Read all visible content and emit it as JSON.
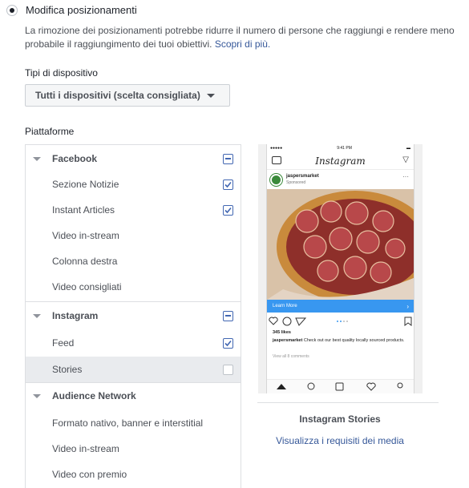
{
  "option": {
    "label": "Modifica posizionamenti",
    "description": "La rimozione dei posizionamenti potrebbe ridurre il numero di persone che raggiungi e rendere meno probabile il raggiungimento dei tuoi obiettivi.",
    "link": "Scopri di più."
  },
  "device": {
    "label": "Tipi di dispositivo",
    "selected": "Tutti i dispositivi (scelta consigliata)"
  },
  "platforms": {
    "label": "Piattaforme",
    "groups": [
      {
        "label": "Facebook",
        "state": "partial",
        "items": [
          {
            "label": "Sezione Notizie",
            "checked": true
          },
          {
            "label": "Instant Articles",
            "checked": true
          },
          {
            "label": "Video in-stream",
            "checked": false
          },
          {
            "label": "Colonna destra",
            "checked": false
          },
          {
            "label": "Video consigliati",
            "checked": false
          }
        ]
      },
      {
        "label": "Instagram",
        "state": "partial",
        "items": [
          {
            "label": "Feed",
            "checked": true
          },
          {
            "label": "Stories",
            "checked": false,
            "highlighted": true
          }
        ]
      },
      {
        "label": "Audience Network",
        "state": "none",
        "items": [
          {
            "label": "Formato nativo, banner e interstitial"
          },
          {
            "label": "Video in-stream"
          },
          {
            "label": "Video con premio"
          }
        ]
      }
    ]
  },
  "preview": {
    "status_time": "9:41 PM",
    "app_name": "Instagram",
    "account": "jaspersmarket",
    "sponsored": "Sponsored",
    "cta": "Learn More",
    "likes": "345 likes",
    "caption_user": "jaspersmarket",
    "caption_text": "Check out our best quality locally sourced products.",
    "comments": "View all 8 comments",
    "title": "Instagram Stories",
    "link": "Visualizza i requisiti dei media"
  },
  "colors": {
    "accent": "#4267b2",
    "link": "#365899",
    "cta": "#3897f0",
    "highlight": "#e9ebee"
  }
}
